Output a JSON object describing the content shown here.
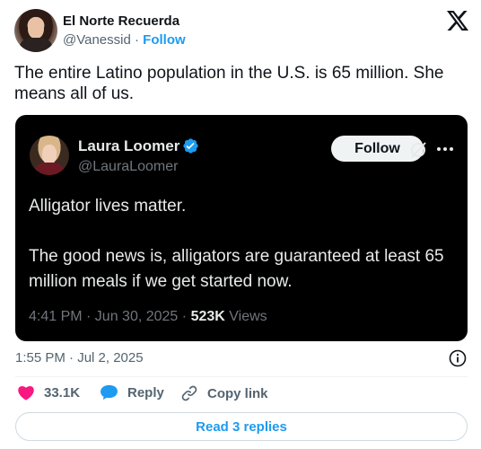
{
  "author": {
    "display_name": "El Norte Recuerda",
    "handle": "@Vanessid",
    "separator": "·",
    "follow_label": "Follow"
  },
  "tweet": {
    "text": "The entire Latino population in the U.S. is 65 million. She means all of us.",
    "timestamp": "1:55 PM · Jul 2, 2025"
  },
  "quoted_tweet": {
    "display_name": "Laura Loomer",
    "handle": "@LauraLoomer",
    "follow_label": "Follow",
    "paragraphs": [
      "Alligator lives matter.",
      "The good news is, alligators are guaranteed at least 65 million meals if we get started now."
    ],
    "meta_time": "4:41 PM · Jun 30, 2025 ·",
    "views_count": "523K",
    "views_label": "Views"
  },
  "actions": {
    "likes": "33.1K",
    "reply_label": "Reply",
    "copy_link_label": "Copy link"
  },
  "replies_button_label": "Read 3 replies",
  "colors": {
    "accent": "#1d9bf0",
    "like": "#f91880",
    "quote_bg": "#000000",
    "muted": "#536471"
  }
}
